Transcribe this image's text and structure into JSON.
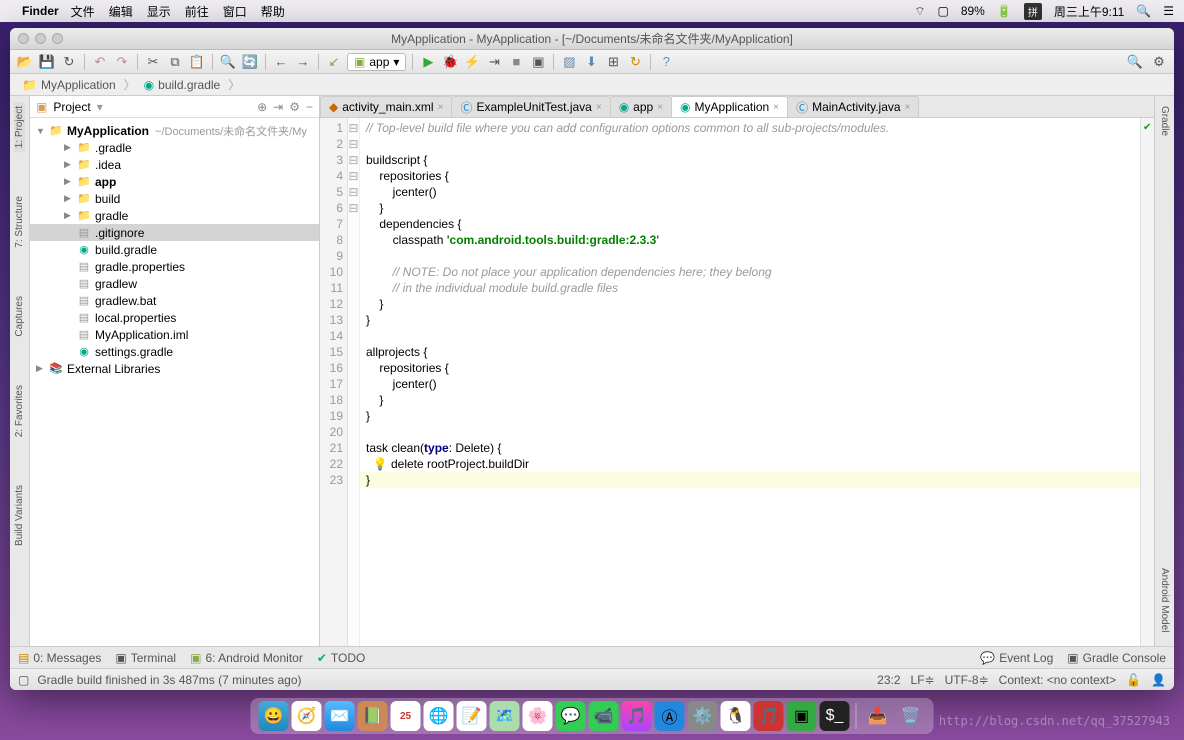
{
  "macos": {
    "app_name": "Finder",
    "menus": [
      "文件",
      "编辑",
      "显示",
      "前往",
      "窗口",
      "帮助"
    ],
    "battery": "89%",
    "ime": "拼",
    "clock": "周三上午9:11"
  },
  "ide": {
    "window_title": "MyApplication - MyApplication - [~/Documents/未命名文件夹/MyApplication]",
    "breadcrumb": [
      "MyApplication",
      "build.gradle"
    ],
    "run_config": "app",
    "left_tabs": [
      "1: Project",
      "7: Structure",
      "Captures",
      "2: Favorites",
      "Build Variants"
    ],
    "right_tabs": [
      "Gradle",
      "Android Model"
    ],
    "project_panel": {
      "title": "Project",
      "root": "MyApplication",
      "root_path": "~/Documents/未命名文件夹/My",
      "items": [
        {
          "type": "folder",
          "name": ".gradle",
          "indent": 2,
          "expandable": true,
          "cls": "folder"
        },
        {
          "type": "folder",
          "name": ".idea",
          "indent": 2,
          "expandable": true,
          "cls": "folder"
        },
        {
          "type": "folder",
          "name": "app",
          "indent": 2,
          "expandable": true,
          "cls": "folder-app",
          "bold": true
        },
        {
          "type": "folder",
          "name": "build",
          "indent": 2,
          "expandable": true,
          "cls": "folder"
        },
        {
          "type": "folder",
          "name": "gradle",
          "indent": 2,
          "expandable": true,
          "cls": "folder"
        },
        {
          "type": "file",
          "name": ".gitignore",
          "indent": 2,
          "cls": "file-txt",
          "selected": true
        },
        {
          "type": "file",
          "name": "build.gradle",
          "indent": 2,
          "cls": "file-gradle"
        },
        {
          "type": "file",
          "name": "gradle.properties",
          "indent": 2,
          "cls": "file-txt"
        },
        {
          "type": "file",
          "name": "gradlew",
          "indent": 2,
          "cls": "file-txt"
        },
        {
          "type": "file",
          "name": "gradlew.bat",
          "indent": 2,
          "cls": "file-txt"
        },
        {
          "type": "file",
          "name": "local.properties",
          "indent": 2,
          "cls": "file-txt"
        },
        {
          "type": "file",
          "name": "MyApplication.iml",
          "indent": 2,
          "cls": "file-txt"
        },
        {
          "type": "file",
          "name": "settings.gradle",
          "indent": 2,
          "cls": "file-gradle"
        }
      ],
      "ext_libs": "External Libraries"
    },
    "tabs": [
      {
        "label": "activity_main.xml",
        "icon": "xml",
        "active": false
      },
      {
        "label": "ExampleUnitTest.java",
        "icon": "java",
        "active": false
      },
      {
        "label": "app",
        "icon": "gradle",
        "active": false
      },
      {
        "label": "MyApplication",
        "icon": "gradle",
        "active": true
      },
      {
        "label": "MainActivity.java",
        "icon": "java",
        "active": false
      }
    ],
    "code_lines": [
      {
        "n": 1,
        "html": "<span class='c-comment'>// Top-level build file where you can add configuration options common to all sub-projects/modules.</span>"
      },
      {
        "n": 2,
        "html": ""
      },
      {
        "n": 3,
        "html": "<span class='c-ident'>buildscript {</span>"
      },
      {
        "n": 4,
        "html": "    <span class='c-ident'>repositories {</span>"
      },
      {
        "n": 5,
        "html": "        <span class='c-ident'>jcenter()</span>"
      },
      {
        "n": 6,
        "html": "    <span class='c-ident'>}</span>"
      },
      {
        "n": 7,
        "html": "    <span class='c-ident'>dependencies {</span>"
      },
      {
        "n": 8,
        "html": "        <span class='c-ident'>classpath </span><span class='c-string'>'com.android.tools.build:gradle:2.3.3'</span>"
      },
      {
        "n": 9,
        "html": ""
      },
      {
        "n": 10,
        "html": "        <span class='c-comment'>// NOTE: Do not place your application dependencies here; they belong</span>"
      },
      {
        "n": 11,
        "html": "        <span class='c-comment'>// in the individual module build.gradle files</span>"
      },
      {
        "n": 12,
        "html": "    <span class='c-ident'>}</span>"
      },
      {
        "n": 13,
        "html": "<span class='c-ident'>}</span>"
      },
      {
        "n": 14,
        "html": ""
      },
      {
        "n": 15,
        "html": "<span class='c-ident'>allprojects {</span>"
      },
      {
        "n": 16,
        "html": "    <span class='c-ident'>repositories {</span>"
      },
      {
        "n": 17,
        "html": "        <span class='c-ident'>jcenter()</span>"
      },
      {
        "n": 18,
        "html": "    <span class='c-ident'>}</span>"
      },
      {
        "n": 19,
        "html": "<span class='c-ident'>}</span>"
      },
      {
        "n": 20,
        "html": ""
      },
      {
        "n": 21,
        "html": "<span class='c-ident'>task clean(</span><span class='c-keyword'>type</span><span class='c-ident'>: Delete) {</span>"
      },
      {
        "n": 22,
        "html": "  <span class='bulb'>💡</span> <span class='c-ident'>delete rootProject.buildDir</span>"
      },
      {
        "n": 23,
        "html": "<span class='c-ident'>}</span>",
        "hl": true
      }
    ],
    "bottom_bar": {
      "messages": "0: Messages",
      "terminal": "Terminal",
      "android_monitor": "6: Android Monitor",
      "todo": "TODO",
      "event_log": "Event Log",
      "gradle_console": "Gradle Console"
    },
    "status": {
      "message": "Gradle build finished in 3s 487ms (7 minutes ago)",
      "pos": "23:2",
      "sep": "LF",
      "enc": "UTF-8",
      "context": "Context: <no context>"
    }
  },
  "watermark": "http://blog.csdn.net/qq_37527943"
}
